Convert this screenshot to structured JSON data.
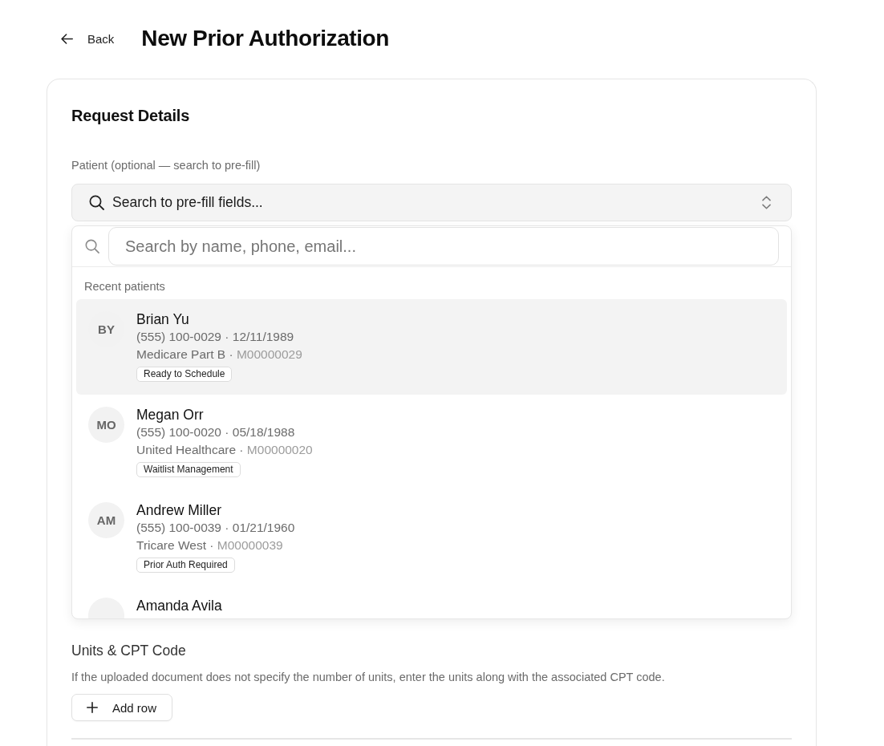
{
  "header": {
    "back_label": "Back",
    "title": "New Prior Authorization"
  },
  "request_details": {
    "title": "Request Details",
    "patient_field": {
      "label": "Patient (optional — search to pre-fill)",
      "text": "Search to pre-fill fields...",
      "expanded": true
    },
    "patient_dropdown": {
      "search": {
        "placeholder": "Search by name, phone, email..."
      },
      "section_label": "Recent patients",
      "patients": [
        {
          "initials": "BY",
          "name": "Brian Yu",
          "contact": "(555) 100-0029 · 12/11/1989",
          "plan": "Medicare Part B ·",
          "member_id": "M00000029",
          "status": "Ready to Schedule",
          "selected": true
        },
        {
          "initials": "MO",
          "name": "Megan Orr",
          "contact": "(555) 100-0020 · 05/18/1988",
          "plan": "United Healthcare ·",
          "member_id": "M00000020",
          "status": "Waitlist Management",
          "selected": false
        },
        {
          "initials": "AM",
          "name": "Andrew Miller",
          "contact": "(555) 100-0039 · 01/21/1960",
          "plan": "Tricare West ·",
          "member_id": "M00000039",
          "status": "Prior Auth Required",
          "selected": false
        },
        {
          "name": "Amanda Avila",
          "selected": false
        }
      ]
    },
    "units_section": {
      "title": "Units & CPT Code",
      "description": "If the uploaded document does not specify the number of units, enter the units along with the associated CPT code.",
      "add_button": "Add row"
    }
  }
}
